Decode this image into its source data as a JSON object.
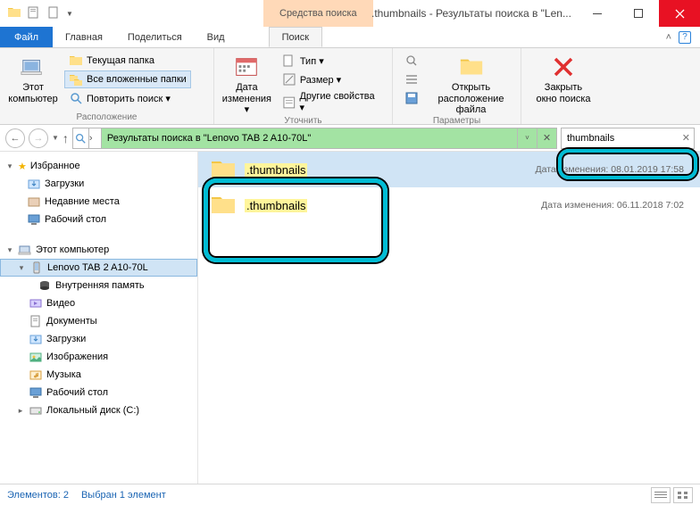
{
  "title": ".thumbnails - Результаты поиска в \"Len...",
  "context_tab": "Средства поиска",
  "file_tab": "Файл",
  "tabs": [
    "Главная",
    "Поделиться",
    "Вид"
  ],
  "search_tab": "Поиск",
  "ribbon": {
    "location": {
      "label": "Расположение",
      "this_pc": "Этот\nкомпьютер",
      "current_folder": "Текущая папка",
      "all_subfolders": "Все вложенные папки",
      "repeat_search": "Повторить поиск ▾"
    },
    "refine": {
      "label": "Уточнить",
      "date": "Дата\nизменения ▾",
      "type": "Тип ▾",
      "size": "Размер ▾",
      "other": "Другие свойства ▾"
    },
    "options": {
      "label": "Параметры",
      "open_location": "Открыть\nрасположение файла",
      "close_search": "Закрыть\nокно поиска"
    }
  },
  "breadcrumb": "Результаты поиска в \"Lenovo TAB 2 A10-70L\"",
  "search_value": "thumbnails",
  "sidebar": {
    "fav": "Избранное",
    "fav_items": [
      "Загрузки",
      "Недавние места",
      "Рабочий стол"
    ],
    "this_pc": "Этот компьютер",
    "pc_items": [
      "Lenovo TAB 2 A10-70L",
      "Внутренняя память",
      "Видео",
      "Документы",
      "Загрузки",
      "Изображения",
      "Музыка",
      "Рабочий стол",
      "Локальный диск (C:)"
    ]
  },
  "results": [
    {
      "name": ".thumbnails",
      "date_label": "Дата изменения: 08.01.2019 17:58"
    },
    {
      "name": ".thumbnails",
      "date_label": "Дата изменения: 06.11.2018 7:02"
    }
  ],
  "status": {
    "count": "Элементов: 2",
    "selected": "Выбран 1 элемент"
  }
}
